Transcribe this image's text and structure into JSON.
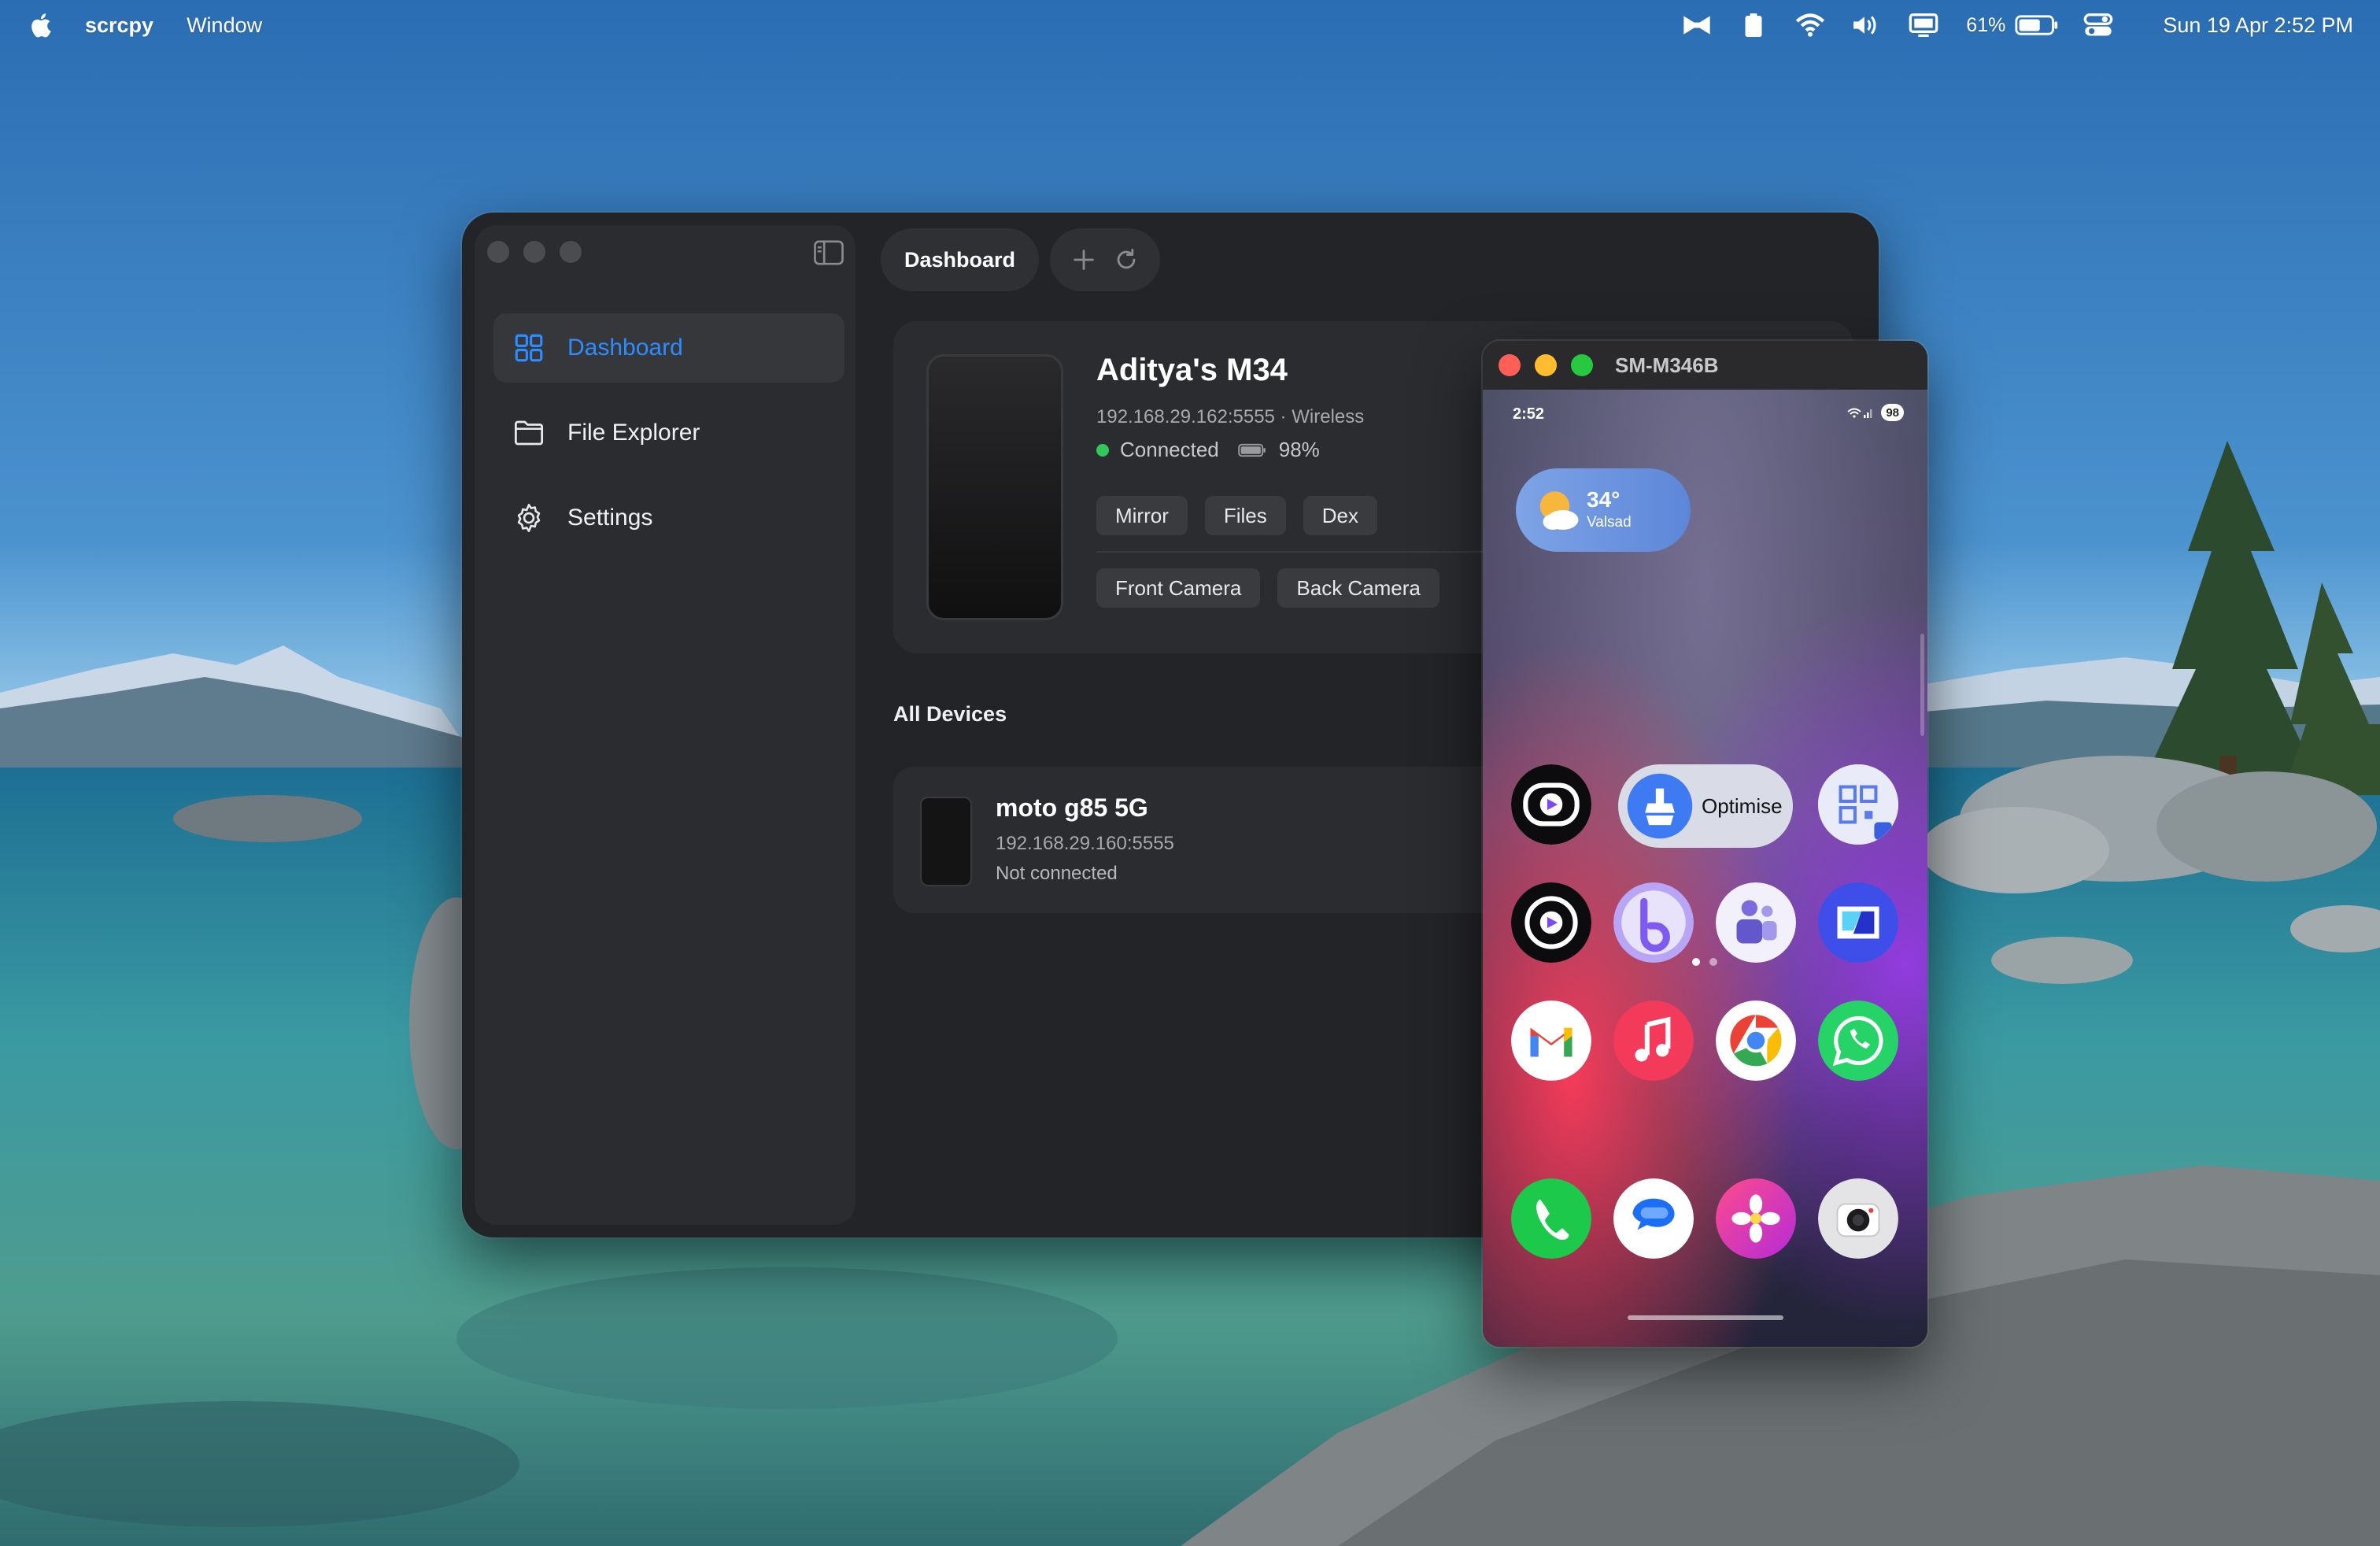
{
  "menubar": {
    "app_name": "scrcpy",
    "menu_items": [
      "Window"
    ],
    "battery_percent": "61%",
    "datetime": "Sun 19 Apr  2:52 PM"
  },
  "app": {
    "tab": "Dashboard",
    "sidebar": {
      "items": [
        {
          "label": "Dashboard",
          "icon": "grid-icon"
        },
        {
          "label": "File Explorer",
          "icon": "folder-icon"
        },
        {
          "label": "Settings",
          "icon": "gear-icon"
        }
      ]
    },
    "current_device": {
      "name": "Aditya's M34",
      "address": "192.168.29.162:5555 · Wireless",
      "status": "Connected",
      "battery": "98%",
      "actions_row1": [
        "Mirror",
        "Files",
        "Dex"
      ],
      "actions_row2": [
        "Front Camera",
        "Back Camera"
      ]
    },
    "all_devices_title": "All Devices",
    "devices": [
      {
        "name": "moto g85 5G",
        "address": "192.168.29.160:5555",
        "status": "Not connected"
      }
    ]
  },
  "mirror": {
    "title": "SM-M346B",
    "status_time": "2:52",
    "battery_badge": "98",
    "weather": {
      "temp": "34°",
      "city": "Valsad"
    },
    "optimise_label": "Optimise",
    "apps": [
      "video-player-icon",
      "optimise-icon",
      "qr-scanner-icon",
      "video-player-icon",
      "bixby-icon",
      "teams-icon",
      "smart-switch-icon",
      "gmail-icon",
      "music-icon",
      "chrome-icon",
      "whatsapp-icon",
      "phone-icon",
      "messages-icon",
      "gallery-icon",
      "camera-icon"
    ]
  }
}
